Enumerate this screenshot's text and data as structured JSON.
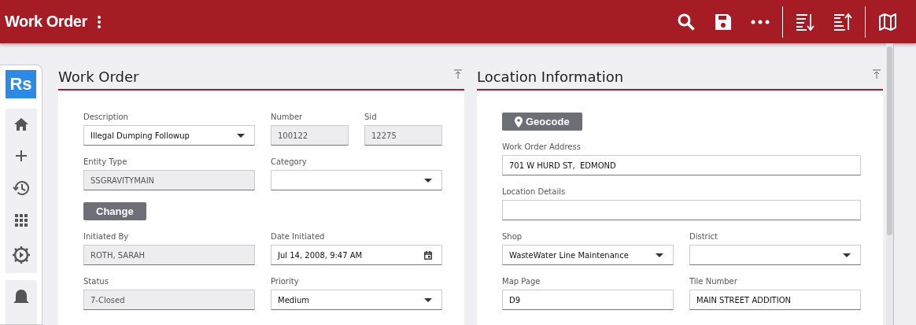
{
  "app_bar": {
    "title": "Work Order"
  },
  "sidebar": {
    "logo": "Rs"
  },
  "panels": [
    {
      "title": "Work Order",
      "rows": [
        [
          {
            "kind": "select",
            "label": "Description",
            "value": "Illegal Dumping Followup"
          },
          {
            "kind": "readonly",
            "label": "Number",
            "value": "100122"
          },
          {
            "kind": "readonly",
            "label": "Sid",
            "value": "12275"
          }
        ],
        [
          {
            "kind": "readonly",
            "label": "Entity Type",
            "value": "SSGRAVITYMAIN"
          },
          {
            "kind": "select",
            "label": "Category"
          }
        ],
        [
          {
            "kind": "button",
            "value": "Change"
          }
        ],
        [
          {
            "kind": "readonly",
            "label": "Initiated By",
            "value": "ROTH, SARAH"
          },
          {
            "kind": "date",
            "label": "Date Initiated",
            "value": "Jul 14, 2008, 9:47 AM"
          }
        ],
        [
          {
            "kind": "readonly",
            "label": "Status",
            "value": "7-Closed"
          },
          {
            "kind": "select",
            "label": "Priority",
            "value": "Medium"
          }
        ]
      ]
    },
    {
      "title": "Location Information",
      "rows": [
        [
          {
            "kind": "geobutton",
            "value": "Geocode"
          }
        ],
        [
          {
            "kind": "input",
            "label": "Work Order Address",
            "value": "701 W HURD ST,  EDMOND"
          }
        ],
        [
          {
            "kind": "input",
            "label": "Location Details"
          }
        ],
        [
          {
            "kind": "select",
            "label": "Shop",
            "value": "WasteWater Line Maintenance"
          },
          {
            "kind": "select",
            "label": "District"
          }
        ],
        [
          {
            "kind": "input",
            "label": "Map Page",
            "value": "D9"
          },
          {
            "kind": "input",
            "label": "Tile Number",
            "value": "MAIN STREET ADDITION"
          }
        ]
      ]
    }
  ]
}
